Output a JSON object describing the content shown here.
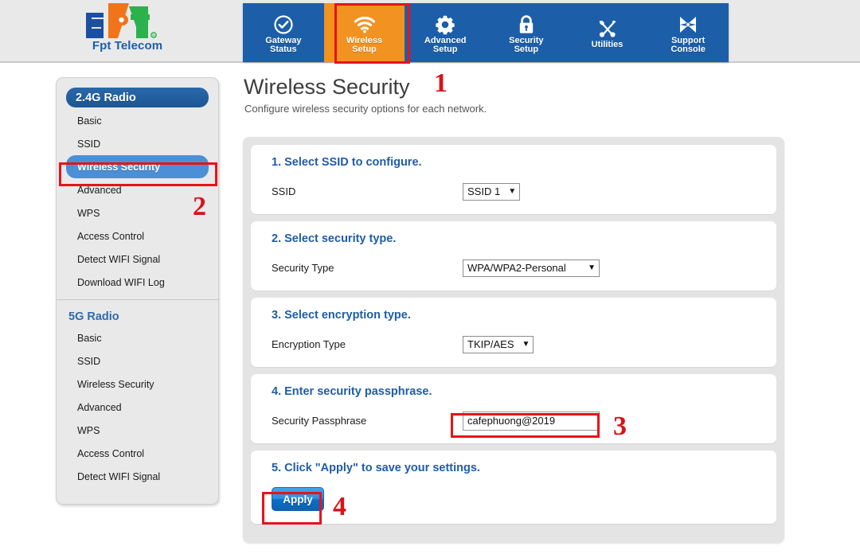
{
  "brand": {
    "name": "Fpt Telecom",
    "logo_icon": "fpt-logo-icon"
  },
  "nav": {
    "items": [
      {
        "label_line1": "Gateway",
        "label_line2": "Status",
        "icon": "check-circle-icon",
        "active": false
      },
      {
        "label_line1": "Wireless",
        "label_line2": "Setup",
        "icon": "wifi-icon",
        "active": true
      },
      {
        "label_line1": "Advanced",
        "label_line2": "Setup",
        "icon": "gear-icon",
        "active": false
      },
      {
        "label_line1": "Security",
        "label_line2": "Setup",
        "icon": "lock-icon",
        "active": false
      },
      {
        "label_line1": "Utilities",
        "label_line2": "",
        "icon": "tools-icon",
        "active": false
      },
      {
        "label_line1": "Support",
        "label_line2": "Console",
        "icon": "support-star-icon",
        "active": false
      }
    ]
  },
  "sidebar": {
    "groups": [
      {
        "title": "2.4G Radio",
        "style": "pill",
        "items": [
          {
            "label": "Basic",
            "selected": false
          },
          {
            "label": "SSID",
            "selected": false
          },
          {
            "label": "Wireless Security",
            "selected": true
          },
          {
            "label": "Advanced",
            "selected": false
          },
          {
            "label": "WPS",
            "selected": false
          },
          {
            "label": "Access Control",
            "selected": false
          },
          {
            "label": "Detect WIFI Signal",
            "selected": false
          },
          {
            "label": "Download WIFI Log",
            "selected": false
          }
        ]
      },
      {
        "title": "5G Radio",
        "style": "plain",
        "items": [
          {
            "label": "Basic",
            "selected": false
          },
          {
            "label": "SSID",
            "selected": false
          },
          {
            "label": "Wireless Security",
            "selected": false
          },
          {
            "label": "Advanced",
            "selected": false
          },
          {
            "label": "WPS",
            "selected": false
          },
          {
            "label": "Access Control",
            "selected": false
          },
          {
            "label": "Detect WIFI Signal",
            "selected": false
          }
        ]
      }
    ]
  },
  "page": {
    "title": "Wireless Security",
    "description": "Configure wireless security options for each network."
  },
  "sections": {
    "ssid": {
      "title": "1. Select SSID to configure.",
      "label": "SSID",
      "value": "SSID 1",
      "caret": "▼"
    },
    "security_type": {
      "title": "2. Select security type.",
      "label": "Security Type",
      "value": "WPA/WPA2-Personal",
      "caret": "▼"
    },
    "encryption_type": {
      "title": "3. Select encryption type.",
      "label": "Encryption Type",
      "value": "TKIP/AES",
      "caret": "▼"
    },
    "passphrase": {
      "title": "4. Enter security passphrase.",
      "label": "Security Passphrase",
      "value": "cafephuong@2019",
      "placeholder": ""
    },
    "apply": {
      "title": "5. Click \"Apply\" to save your settings.",
      "button_label": "Apply"
    }
  },
  "annotations": {
    "marker_1": "1",
    "marker_2": "2",
    "marker_3": "3",
    "marker_4": "4"
  },
  "colors": {
    "nav_blue": "#1c5fa8",
    "active_orange": "#f29220",
    "annotation_red": "#e8121b",
    "heading_blue": "#1f5ca8",
    "selected_item_blue": "#4b90d6"
  }
}
